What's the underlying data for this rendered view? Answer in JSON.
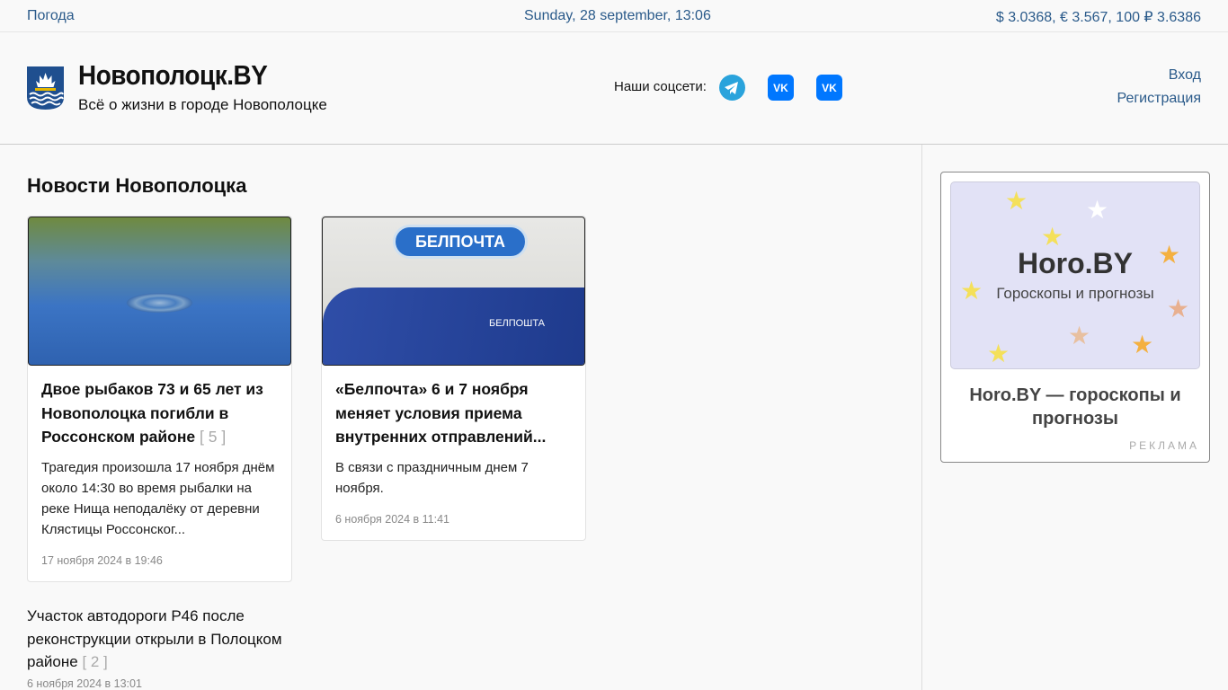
{
  "topbar": {
    "weather": "Погода",
    "datetime": "Sunday, 28 september, 13:06",
    "rates": "$ 3.0368, € 3.567, 100 ₽ 3.6386"
  },
  "header": {
    "title": "Новополоцк.BY",
    "subtitle": "Всё о жизни в городе Новополоцке",
    "social_label": "Наши соцсети:",
    "login": "Вход",
    "register": "Регистрация"
  },
  "news": {
    "section_title": "Новости Новополоцка",
    "cards": [
      {
        "title": "Двое рыбаков 73 и 65 лет из Новополоцка погибли в Россонском районе",
        "comments": "[ 5 ]",
        "excerpt": "Трагедия произошла 17 ноября днём около 14:30 во время рыбалки на реке Нища неподалёку от деревни Клястицы Россонског...",
        "date": "17 ноября 2024 в 19:46"
      },
      {
        "title": "«Белпочта» 6 и 7 ноября меняет условия приема внутренних отправлений...",
        "excerpt": "В связи с праздничным днем 7 ноября.",
        "date": "6 ноября 2024 в 11:41",
        "image_text": "БЕЛПОЧТА",
        "van_text": "БЕЛПОШТА"
      }
    ],
    "list": [
      {
        "title": "Участок автодороги Р46 после реконструкции открыли в Полоцком районе",
        "comments": "[ 2 ]",
        "date": "6 ноября 2024 в 13:01"
      }
    ]
  },
  "ad": {
    "image_title": "Horo.BY",
    "image_sub": "Гороскопы и прогнозы",
    "title": "Horo.BY — гороскопы и прогнозы",
    "label": "РЕКЛАМА"
  }
}
